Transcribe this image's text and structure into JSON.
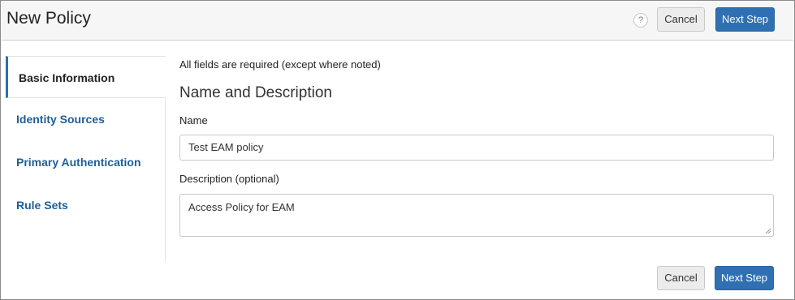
{
  "header": {
    "title": "New Policy",
    "help_icon": "?",
    "cancel_label": "Cancel",
    "next_label": "Next Step"
  },
  "sidebar": {
    "items": [
      {
        "label": "Basic Information",
        "active": true
      },
      {
        "label": "Identity Sources",
        "active": false
      },
      {
        "label": "Primary Authentication",
        "active": false
      },
      {
        "label": "Rule Sets",
        "active": false
      }
    ]
  },
  "form": {
    "required_note": "All fields are required (except where noted)",
    "section_title": "Name and Description",
    "name_label": "Name",
    "name_value": "Test EAM policy",
    "description_label": "Description (optional)",
    "description_value": "Access Policy for EAM"
  },
  "footer": {
    "cancel_label": "Cancel",
    "next_label": "Next Step"
  },
  "colors": {
    "primary": "#2f70b3",
    "nav_link": "#1d5f98"
  }
}
